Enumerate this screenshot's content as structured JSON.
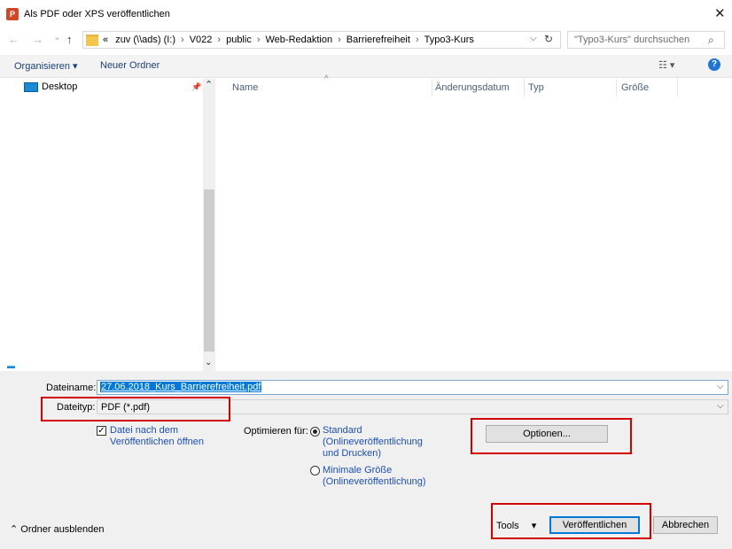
{
  "window": {
    "title": "Als PDF oder XPS veröffentlichen",
    "app_icon_letter": "P",
    "close_glyph": "✕"
  },
  "nav": {
    "back": "←",
    "forward": "→",
    "recent": "⌄",
    "up": "↑",
    "breadcrumbs": [
      "«",
      "zuv (\\\\ads) (I:)",
      "V022",
      "public",
      "Web-Redaktion",
      "Barrierefreiheit",
      "Typo3-Kurs"
    ],
    "search_placeholder": "\"Typo3-Kurs\" durchsuchen"
  },
  "toolbar": {
    "organize": "Organisieren ▾",
    "new_folder": "Neuer Ordner",
    "help": "?"
  },
  "nav_pane": {
    "items": [
      {
        "label": "Desktop",
        "icon": "monitor-icon"
      }
    ]
  },
  "columns": [
    "Name",
    "Änderungsdatum",
    "Typ",
    "Größe"
  ],
  "form": {
    "filename_label": "Dateiname:",
    "filename_value": "27.06.2018_Kurs_Barrierefreiheit.pdf",
    "filetype_label": "Dateityp:",
    "filetype_value": "PDF (*.pdf)",
    "open_after_publish": "Datei nach dem Veröffentlichen öffnen",
    "open_after_publish_checked": true,
    "optimize_label": "Optimieren für:",
    "option_standard": "Standard (Onlineveröffentlichung und Drucken)",
    "option_minimal": "Minimale Größe (Onlineveröffentlichung)",
    "selected_option": "standard",
    "options_button": "Optionen..."
  },
  "footer": {
    "hide_folders": "Ordner ausblenden",
    "tools": "Tools",
    "publish": "Veröffentlichen",
    "cancel": "Abbrechen"
  },
  "colors": {
    "highlight_red": "#d40000",
    "accent_blue": "#0078d7",
    "link_blue": "#1c4fb5"
  }
}
